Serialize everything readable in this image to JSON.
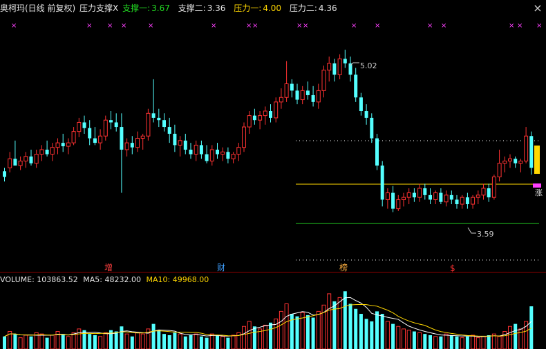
{
  "header": {
    "title": "奥柯玛(日线 前复权)",
    "indicator": "压力支撑X",
    "s1_label": "支撑一:",
    "s1_value": "3.67",
    "s2_label": "支撑二:",
    "s2_value": "3.36",
    "p1_label": "压力一:",
    "p1_value": "4.00",
    "p2_label": "压力二:",
    "p2_value": "4.36"
  },
  "volume_header": {
    "label": "VOLUME:",
    "value": "103863.52",
    "ma5_label": "MA5:",
    "ma5_value": "48232.00",
    "ma10_label": "MA10:",
    "ma10_value": "49968.00"
  },
  "annotations": {
    "high": "5.02",
    "low": "3.59",
    "tag_zeng": "增",
    "tag_cai": "财",
    "tag_bang": "榜",
    "tag_dollar": "$",
    "right_edge": "涨"
  },
  "colors": {
    "up": "#ff3232",
    "down": "#54ffff",
    "support_one": "#22cc22",
    "support_two": "#2ecc2e",
    "pressure_one": "#ffd700",
    "pressure_two": "#ffffff",
    "ma5": "#ffffff",
    "ma10": "#ffd700"
  },
  "chart_data": {
    "type": "candlestick",
    "price_range": [
      3.15,
      5.3
    ],
    "levels": {
      "support_one": 3.67,
      "support_two": 3.36,
      "pressure_one": 4.0,
      "pressure_two": 4.36
    },
    "candles": [
      [
        3.95,
        3.98,
        3.86,
        3.9
      ],
      [
        3.98,
        4.12,
        3.94,
        4.06
      ],
      [
        4.06,
        4.22,
        4.0,
        4.0
      ],
      [
        4.0,
        4.08,
        3.96,
        4.04
      ],
      [
        4.04,
        4.12,
        3.98,
        4.08
      ],
      [
        4.08,
        4.14,
        4.0,
        4.02
      ],
      [
        4.02,
        4.14,
        3.98,
        4.1
      ],
      [
        4.1,
        4.18,
        4.04,
        4.14
      ],
      [
        4.14,
        4.22,
        4.08,
        4.1
      ],
      [
        4.1,
        4.2,
        4.04,
        4.16
      ],
      [
        4.16,
        4.24,
        4.1,
        4.2
      ],
      [
        4.2,
        4.28,
        4.12,
        4.17
      ],
      [
        4.17,
        4.24,
        4.1,
        4.2
      ],
      [
        4.2,
        4.34,
        4.18,
        4.3
      ],
      [
        4.3,
        4.42,
        4.25,
        4.38
      ],
      [
        4.38,
        4.44,
        4.28,
        4.33
      ],
      [
        4.33,
        4.4,
        4.18,
        4.24
      ],
      [
        4.24,
        4.34,
        4.18,
        4.2
      ],
      [
        4.2,
        4.32,
        4.14,
        4.26
      ],
      [
        4.26,
        4.44,
        4.22,
        4.4
      ],
      [
        4.4,
        4.48,
        4.32,
        4.38
      ],
      [
        4.38,
        4.46,
        4.3,
        4.34
      ],
      [
        4.34,
        4.46,
        3.76,
        4.14
      ],
      [
        4.14,
        4.24,
        4.08,
        4.2
      ],
      [
        4.2,
        4.26,
        4.1,
        4.16
      ],
      [
        4.16,
        4.3,
        4.12,
        4.24
      ],
      [
        4.24,
        4.28,
        4.14,
        4.26
      ],
      [
        4.26,
        4.5,
        4.22,
        4.46
      ],
      [
        4.46,
        4.76,
        4.38,
        4.42
      ],
      [
        4.42,
        4.5,
        4.34,
        4.4
      ],
      [
        4.4,
        4.46,
        4.3,
        4.34
      ],
      [
        4.34,
        4.42,
        4.2,
        4.28
      ],
      [
        4.28,
        4.36,
        4.12,
        4.18
      ],
      [
        4.18,
        4.26,
        4.08,
        4.22
      ],
      [
        4.22,
        4.28,
        4.1,
        4.14
      ],
      [
        4.14,
        4.2,
        4.06,
        4.1
      ],
      [
        4.1,
        4.22,
        4.04,
        4.18
      ],
      [
        4.18,
        4.22,
        4.06,
        4.1
      ],
      [
        4.1,
        4.18,
        4.02,
        4.04
      ],
      [
        4.04,
        4.18,
        4.0,
        4.14
      ],
      [
        4.14,
        4.2,
        4.06,
        4.1
      ],
      [
        4.1,
        4.16,
        4.04,
        4.12
      ],
      [
        4.12,
        4.16,
        4.02,
        4.06
      ],
      [
        4.06,
        4.12,
        4.02,
        4.1
      ],
      [
        4.1,
        4.2,
        4.04,
        4.16
      ],
      [
        4.16,
        4.38,
        4.12,
        4.34
      ],
      [
        4.34,
        4.48,
        4.28,
        4.44
      ],
      [
        4.44,
        4.5,
        4.36,
        4.4
      ],
      [
        4.4,
        4.48,
        4.32,
        4.44
      ],
      [
        4.44,
        4.52,
        4.36,
        4.48
      ],
      [
        4.48,
        4.54,
        4.38,
        4.42
      ],
      [
        4.42,
        4.6,
        4.38,
        4.56
      ],
      [
        4.56,
        4.68,
        4.5,
        4.6
      ],
      [
        4.6,
        4.92,
        4.56,
        4.72
      ],
      [
        4.72,
        4.76,
        4.6,
        4.66
      ],
      [
        4.66,
        4.72,
        4.54,
        4.58
      ],
      [
        4.58,
        4.7,
        4.54,
        4.66
      ],
      [
        4.66,
        4.74,
        4.58,
        4.62
      ],
      [
        4.62,
        4.7,
        4.52,
        4.56
      ],
      [
        4.56,
        4.72,
        4.5,
        4.66
      ],
      [
        4.66,
        4.88,
        4.6,
        4.84
      ],
      [
        4.84,
        4.96,
        4.74,
        4.9
      ],
      [
        4.9,
        4.94,
        4.74,
        4.8
      ],
      [
        4.8,
        4.98,
        4.76,
        4.94
      ],
      [
        4.94,
        5.02,
        4.86,
        4.9
      ],
      [
        4.9,
        4.96,
        4.74,
        4.8
      ],
      [
        4.8,
        4.86,
        4.56,
        4.6
      ],
      [
        4.6,
        4.64,
        4.44,
        4.48
      ],
      [
        4.48,
        4.54,
        4.36,
        4.42
      ],
      [
        4.42,
        4.46,
        4.2,
        4.24
      ],
      [
        4.24,
        4.28,
        3.96,
        4.0
      ],
      [
        4.0,
        4.04,
        3.64,
        3.7
      ],
      [
        3.7,
        3.8,
        3.62,
        3.76
      ],
      [
        3.76,
        3.82,
        3.59,
        3.62
      ],
      [
        3.62,
        3.74,
        3.6,
        3.7
      ],
      [
        3.7,
        3.76,
        3.64,
        3.72
      ],
      [
        3.72,
        3.8,
        3.66,
        3.76
      ],
      [
        3.76,
        3.8,
        3.68,
        3.72
      ],
      [
        3.72,
        3.84,
        3.68,
        3.8
      ],
      [
        3.8,
        3.84,
        3.7,
        3.74
      ],
      [
        3.74,
        3.8,
        3.66,
        3.7
      ],
      [
        3.7,
        3.78,
        3.66,
        3.76
      ],
      [
        3.76,
        3.8,
        3.66,
        3.68
      ],
      [
        3.68,
        3.78,
        3.64,
        3.74
      ],
      [
        3.74,
        3.78,
        3.66,
        3.7
      ],
      [
        3.7,
        3.74,
        3.62,
        3.66
      ],
      [
        3.66,
        3.74,
        3.62,
        3.72
      ],
      [
        3.72,
        3.76,
        3.62,
        3.66
      ],
      [
        3.66,
        3.74,
        3.62,
        3.72
      ],
      [
        3.72,
        3.78,
        3.66,
        3.74
      ],
      [
        3.74,
        3.84,
        3.7,
        3.8
      ],
      [
        3.8,
        3.84,
        3.68,
        3.72
      ],
      [
        3.72,
        3.92,
        3.7,
        3.9
      ],
      [
        3.9,
        4.14,
        3.86,
        4.02
      ],
      [
        4.02,
        4.08,
        3.94,
        4.04
      ],
      [
        4.04,
        4.1,
        3.98,
        4.06
      ],
      [
        4.06,
        4.08,
        3.98,
        4.02
      ],
      [
        4.02,
        4.06,
        3.94,
        4.04
      ],
      [
        4.04,
        4.34,
        4.02,
        4.26
      ],
      [
        4.26,
        4.3,
        3.92,
        3.98
      ]
    ],
    "volume": [
      10,
      14,
      12,
      9,
      11,
      10,
      13,
      12,
      9,
      11,
      14,
      12,
      10,
      13,
      16,
      15,
      12,
      11,
      10,
      13,
      15,
      14,
      18,
      12,
      10,
      13,
      12,
      16,
      20,
      15,
      12,
      11,
      13,
      12,
      10,
      11,
      12,
      10,
      9,
      12,
      11,
      10,
      9,
      11,
      13,
      18,
      22,
      18,
      16,
      19,
      21,
      24,
      30,
      36,
      28,
      26,
      29,
      27,
      25,
      30,
      35,
      44,
      38,
      41,
      46,
      36,
      32,
      28,
      24,
      22,
      30,
      28,
      22,
      20,
      18,
      16,
      15,
      14,
      13,
      12,
      11,
      10,
      10,
      12,
      11,
      10,
      9,
      10,
      11,
      9,
      10,
      11,
      12,
      10,
      14,
      18,
      20,
      16,
      22,
      34
    ],
    "volume_max": 50
  }
}
